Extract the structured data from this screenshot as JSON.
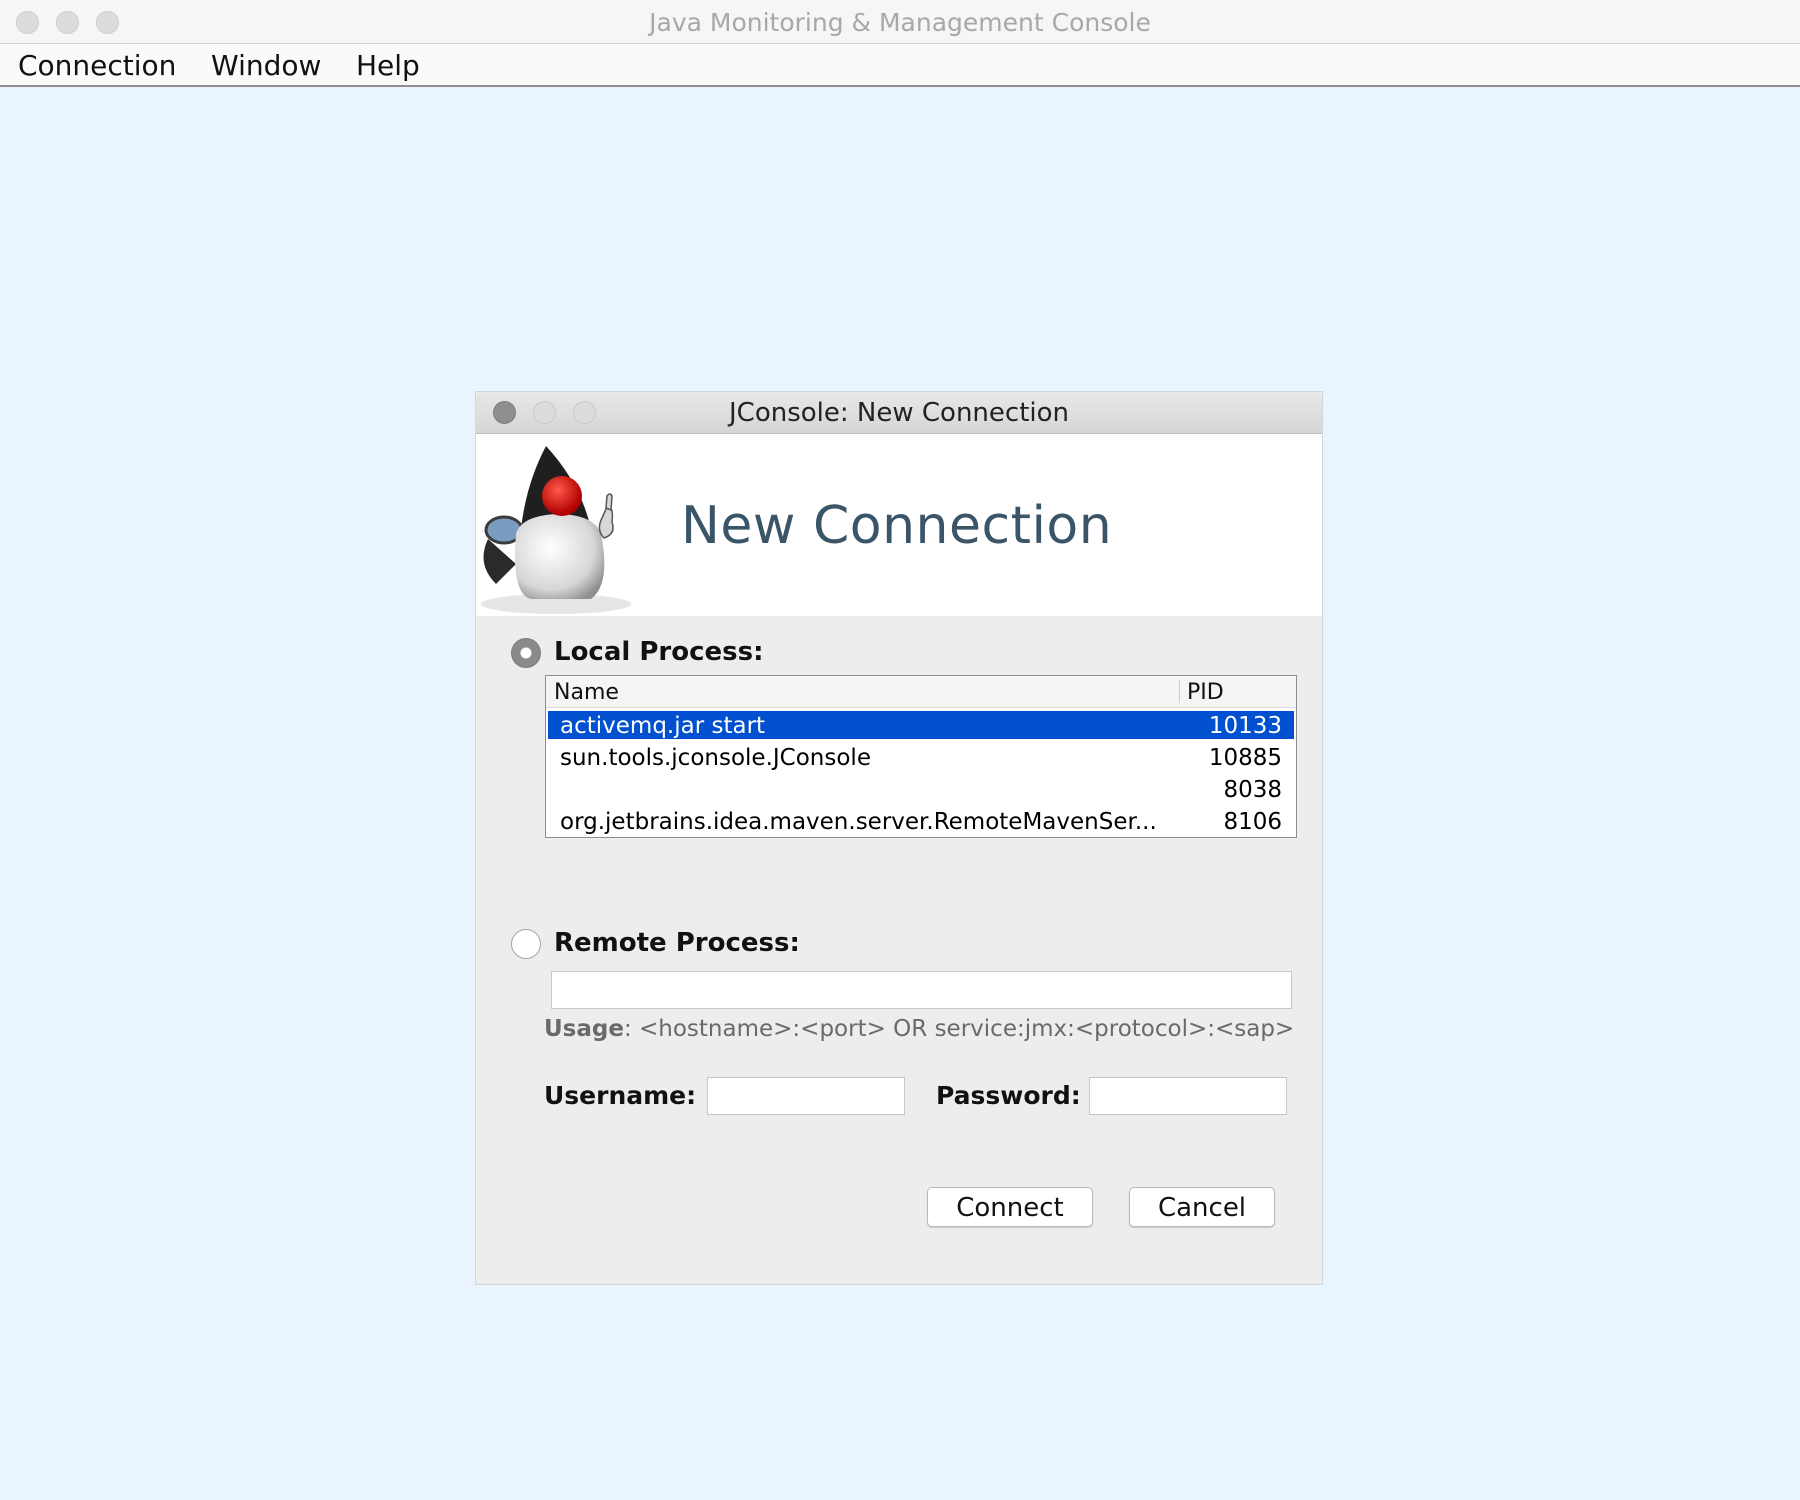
{
  "app": {
    "title": "Java Monitoring & Management Console",
    "menu": [
      "Connection",
      "Window",
      "Help"
    ]
  },
  "dialog": {
    "title": "JConsole: New Connection",
    "banner_title": "New Connection",
    "local": {
      "label": "Local Process:",
      "selected": true,
      "columns": {
        "name": "Name",
        "pid": "PID"
      },
      "rows": [
        {
          "name": "activemq.jar start",
          "pid": "10133"
        },
        {
          "name": "sun.tools.jconsole.JConsole",
          "pid": "10885"
        },
        {
          "name": "",
          "pid": "8038"
        },
        {
          "name": "org.jetbrains.idea.maven.server.RemoteMavenSer...",
          "pid": "8106"
        }
      ],
      "selected_row": 0
    },
    "remote": {
      "label": "Remote Process:",
      "selected": false,
      "value": "",
      "usage_bold": "Usage",
      "usage_text": ": <hostname>:<port> OR service:jmx:<protocol>:<sap>"
    },
    "username_label": "Username:",
    "password_label": "Password:",
    "username_value": "",
    "password_value": "",
    "connect_label": "Connect",
    "cancel_label": "Cancel"
  },
  "colors": {
    "desktop": "#eaf4fe",
    "selection": "#0150d0",
    "banner_title": "#3a5468"
  }
}
